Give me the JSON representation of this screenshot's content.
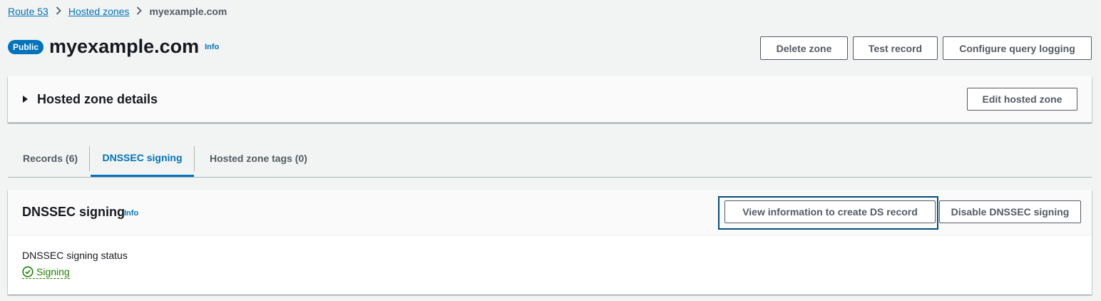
{
  "breadcrumb": {
    "items": [
      "Route 53",
      "Hosted zones"
    ],
    "current": "myexample.com",
    "separator": ">"
  },
  "header": {
    "badge": "Public",
    "title": "myexample.com",
    "info": "Info",
    "actions": {
      "delete_zone": "Delete zone",
      "test_record": "Test record",
      "configure_logging": "Configure query logging"
    }
  },
  "details": {
    "title": "Hosted zone details",
    "edit_button": "Edit hosted zone"
  },
  "tabs": [
    {
      "label": "Records (6)"
    },
    {
      "label": "DNSSEC signing"
    },
    {
      "label": "Hosted zone tags (0)"
    }
  ],
  "dnssec": {
    "title": "DNSSEC signing",
    "info": "Info",
    "view_button": "View information to create DS record",
    "disable_button": "Disable DNSSEC signing",
    "status_label": "DNSSEC signing status",
    "status_value": "Signing"
  },
  "colors": {
    "link": "#0073bb",
    "success": "#1d8102",
    "focus": "#00507a"
  },
  "icons": {
    "caret": "caret-right-icon",
    "status": "check-circle-icon"
  }
}
